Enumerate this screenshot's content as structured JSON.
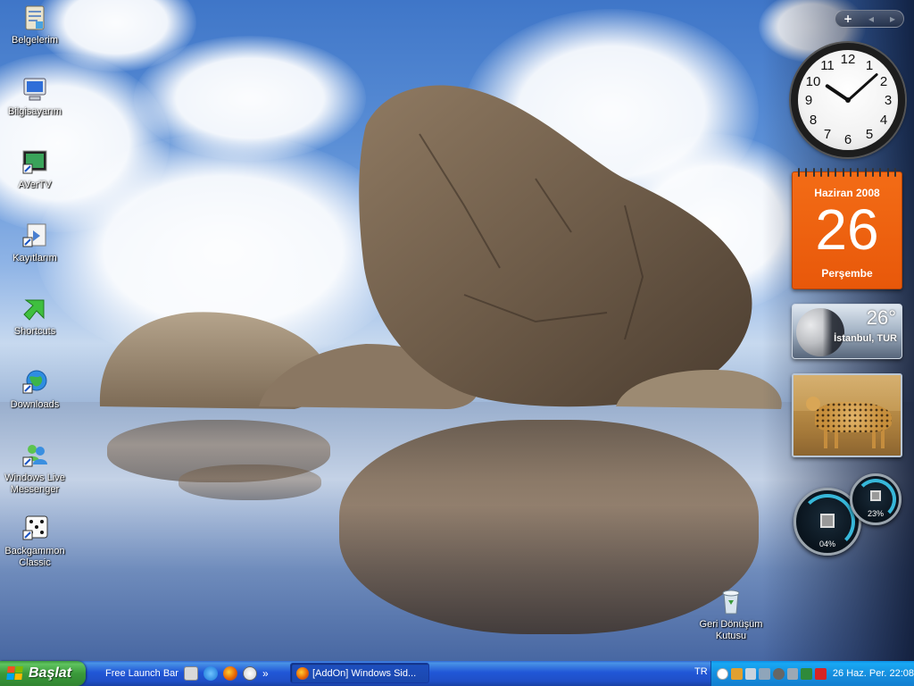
{
  "desktop": {
    "icons": [
      {
        "label": "Belgelerim",
        "icon": "documents-folder-icon"
      },
      {
        "label": "Bilgisayarım",
        "icon": "my-computer-icon"
      },
      {
        "label": "AVerTV",
        "icon": "avertv-icon"
      },
      {
        "label": "Kayıtlarım",
        "icon": "recordings-shortcut-icon"
      },
      {
        "label": "Shortcuts",
        "icon": "shortcut-arrow-icon"
      },
      {
        "label": "Downloads",
        "icon": "downloads-globe-icon"
      },
      {
        "label": "Windows Live Messenger",
        "icon": "messenger-icon"
      },
      {
        "label": "Backgammon Classic",
        "icon": "dice-icon"
      }
    ],
    "recycle_bin": {
      "label": "Geri Dönüşüm Kutusu",
      "icon": "recycle-bin-icon"
    }
  },
  "sidebar": {
    "controls": {
      "add": "+",
      "prev": "◂",
      "next": "▸"
    },
    "clock": {
      "numbers": [
        "12",
        "1",
        "2",
        "3",
        "4",
        "5",
        "6",
        "7",
        "8",
        "9",
        "10",
        "11"
      ],
      "time": "22:08"
    },
    "calendar": {
      "month": "Haziran 2008",
      "day": "26",
      "weekday": "Perşembe"
    },
    "weather": {
      "temperature": "26°",
      "city": "İstanbul, TUR"
    },
    "meters": {
      "cpu": "04%",
      "memory": "23%"
    }
  },
  "taskbar": {
    "start_label": "Başlat",
    "quick_launch_label": "Free Launch Bar",
    "overflow": "»",
    "window_button": "[AddOn] Windows Sid...",
    "language": "TR",
    "datetime": "26 Haz. Per. 22:08"
  },
  "colors": {
    "taskbar_blue": "#2157d7",
    "start_green": "#3a9a3a",
    "tray_blue": "#1690e0",
    "calendar_orange": "#e8580a"
  }
}
